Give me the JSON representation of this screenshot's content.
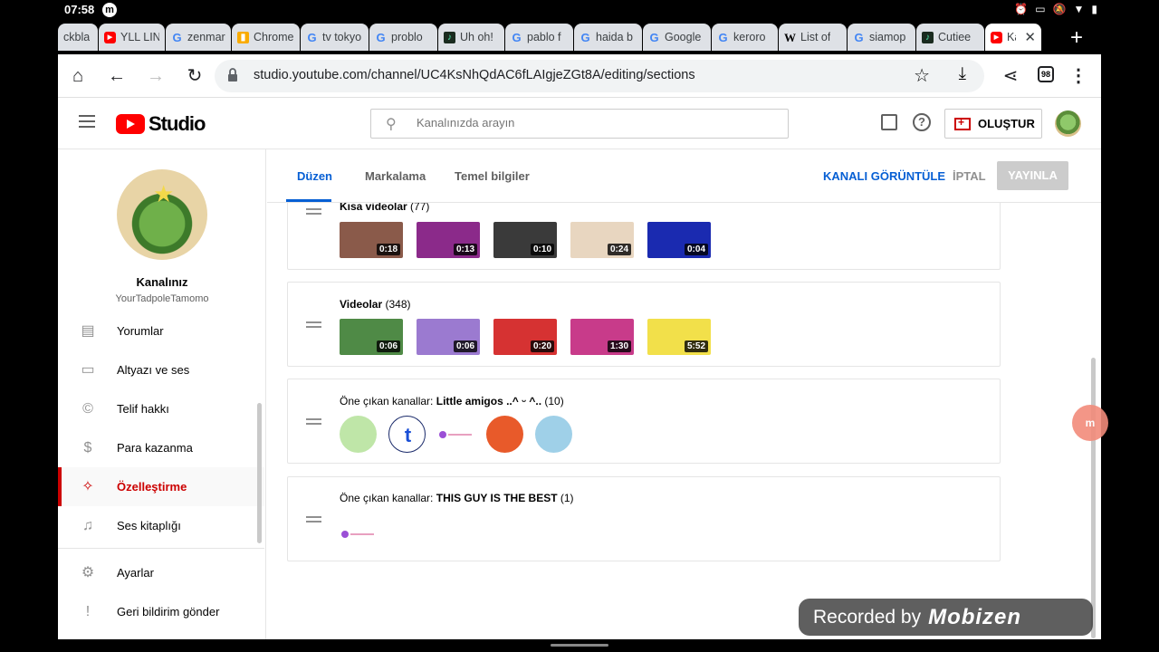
{
  "status_bar": {
    "time": "07:58",
    "app_icon": "m",
    "right_icons": [
      "alarm-icon",
      "cast-icon",
      "mute-icon",
      "wifi-icon",
      "battery-icon"
    ]
  },
  "browser": {
    "tabs": [
      {
        "label": "ckbla",
        "favicon": "none"
      },
      {
        "label": "YLL LIN",
        "favicon": "youtube"
      },
      {
        "label": "zenmar",
        "favicon": "google"
      },
      {
        "label": "Chrome",
        "favicon": "chrome-store"
      },
      {
        "label": "tv tokyo",
        "favicon": "google"
      },
      {
        "label": "problo",
        "favicon": "google"
      },
      {
        "label": "Uh oh!",
        "favicon": "tiktok"
      },
      {
        "label": "pablo f",
        "favicon": "google"
      },
      {
        "label": "haida b",
        "favicon": "google"
      },
      {
        "label": "Google",
        "favicon": "google"
      },
      {
        "label": "keroro",
        "favicon": "google"
      },
      {
        "label": "List of",
        "favicon": "wikipedia"
      },
      {
        "label": "siamop",
        "favicon": "google"
      },
      {
        "label": "Cutiee",
        "favicon": "tiktok"
      },
      {
        "label": "Kan",
        "favicon": "youtube",
        "active": true
      }
    ],
    "url": "studio.youtube.com/channel/UC4KsNhQdAC6fLAIgjeZGt8A/editing/sections",
    "tab_count": "98"
  },
  "studio": {
    "logo_text": "Studio",
    "search_placeholder": "Kanalınızda arayın",
    "create_label": "OLUŞTUR"
  },
  "sidebar": {
    "channel_label": "Kanalınız",
    "channel_handle": "YourTadpoleTamomo",
    "items": [
      {
        "label": "Yorumlar",
        "icon": "comment-icon"
      },
      {
        "label": "Altyazı ve ses",
        "icon": "subtitles-icon"
      },
      {
        "label": "Telif hakkı",
        "icon": "copyright-icon"
      },
      {
        "label": "Para kazanma",
        "icon": "dollar-icon"
      },
      {
        "label": "Özelleştirme",
        "icon": "magic-wand-icon",
        "active": true
      },
      {
        "label": "Ses kitaplığı",
        "icon": "audio-library-icon"
      },
      {
        "label": "Ayarlar",
        "icon": "settings-icon"
      },
      {
        "label": "Geri bildirim gönder",
        "icon": "feedback-icon"
      }
    ]
  },
  "customization": {
    "tabs": [
      "Düzen",
      "Markalama",
      "Temel bilgiler"
    ],
    "active_tab": "Düzen",
    "view_channel": "KANALI GÖRÜNTÜLE",
    "cancel": "İPTAL",
    "publish": "YAYINLA",
    "sections": [
      {
        "title": "Kısa videolar",
        "count": "(77)",
        "thumbs": [
          {
            "duration": "0:18",
            "color": "#8a5a4a"
          },
          {
            "duration": "0:13",
            "color": "#8b2a8a"
          },
          {
            "duration": "0:10",
            "color": "#3a3a3a"
          },
          {
            "duration": "0:24",
            "color": "#e8d6c0"
          },
          {
            "duration": "0:04",
            "color": "#1a2ab0"
          }
        ]
      },
      {
        "title": "Videolar",
        "count": "(348)",
        "thumbs": [
          {
            "duration": "0:06",
            "color": "#4f8a46"
          },
          {
            "duration": "0:06",
            "color": "#9b7ad0"
          },
          {
            "duration": "0:20",
            "color": "#d63232"
          },
          {
            "duration": "1:30",
            "color": "#c83b8a"
          },
          {
            "duration": "5:52",
            "color": "#f2e04a"
          }
        ]
      },
      {
        "prefix": "Öne çıkan kanallar: ",
        "title": "Little amigos ..^ ᵕ ^..",
        "count": "(10)",
        "channels": [
          {
            "color": "#bfe6a8",
            "glyph": ""
          },
          {
            "color": "#ffffff",
            "glyph": "t",
            "glyph_color": "#1a4fd6"
          },
          {
            "color": "#ffffff",
            "glyph": "",
            "small": true
          },
          {
            "color": "#e85a2a",
            "glyph": ""
          },
          {
            "color": "#9fd0e8",
            "glyph": ""
          }
        ]
      },
      {
        "prefix": "Öne çıkan kanallar: ",
        "title": "THIS GUY IS THE BEST",
        "count": "(1)",
        "channels": [
          {
            "color": "#ffffff",
            "glyph": "",
            "small": true
          }
        ]
      }
    ]
  },
  "watermark": {
    "text": "Recorded by",
    "brand": "Mobizen"
  },
  "floating_bubble": "m"
}
